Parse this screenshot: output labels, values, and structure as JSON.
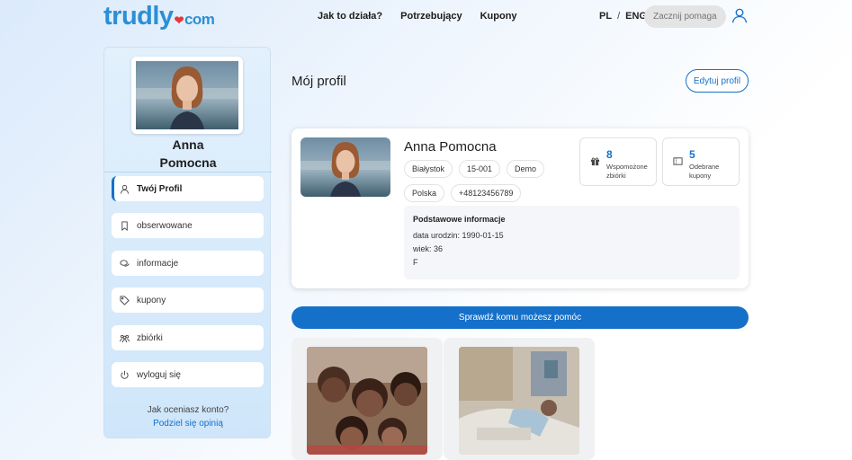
{
  "header": {
    "logo_main": "trudly",
    "logo_suffix": "com",
    "nav": [
      "Jak to działa?",
      "Potrzebujący",
      "Kupony"
    ],
    "lang_pl": "PL",
    "lang_sep": "/",
    "lang_eng": "ENG",
    "search_placeholder": "Zacznij pomagać"
  },
  "sidebar": {
    "name_first": "Anna",
    "name_last": "Pomocna",
    "items": [
      {
        "label": "Twój Profil",
        "icon": "user-icon"
      },
      {
        "label": "obserwowane",
        "icon": "bookmark-icon"
      },
      {
        "label": "informacje",
        "icon": "chat-icon"
      },
      {
        "label": "kupony",
        "icon": "tag-icon"
      },
      {
        "label": "zbiórki",
        "icon": "group-icon"
      },
      {
        "label": "wyloguj się",
        "icon": "power-icon"
      }
    ],
    "feedback_question": "Jak oceniasz konto?",
    "feedback_link": "Podziel się opinią"
  },
  "main": {
    "title": "Mój profil",
    "edit_button": "Edytuj profil",
    "profile": {
      "name": "Anna Pomocna",
      "tags": [
        "Białystok",
        "15-001",
        "Demo",
        "Polska",
        "+48123456789"
      ],
      "stats": [
        {
          "value": "8",
          "label": "Wspomożone zbiórki",
          "icon": "gift-icon"
        },
        {
          "value": "5",
          "label": "Odebrane kupony",
          "icon": "ticket-icon"
        }
      ],
      "info_title": "Podstawowe informacje",
      "info_rows": [
        "data urodzin: 1990-01-15",
        "wiek: 36",
        "F"
      ]
    },
    "cta_label": "Sprawdź komu możesz pomóc"
  },
  "colors": {
    "accent": "#1570c9",
    "logo": "#2a8fd6",
    "heart": "#e23b3b"
  }
}
